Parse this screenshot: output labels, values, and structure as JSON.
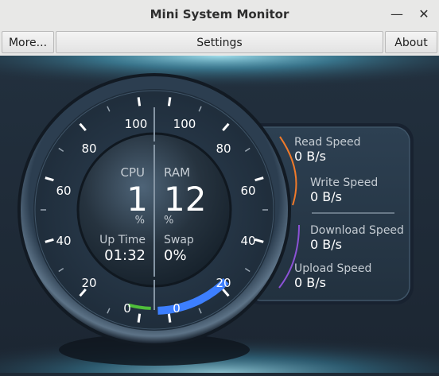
{
  "window": {
    "title": "Mini System Monitor",
    "minimize_glyph": "—",
    "close_glyph": "✕"
  },
  "toolbar": {
    "more_label": "More...",
    "settings_label": "Settings",
    "about_label": "About"
  },
  "gauge": {
    "left_ticks": [
      "100",
      "80",
      "60",
      "40",
      "20",
      "0"
    ],
    "right_ticks": [
      "100",
      "80",
      "60",
      "40",
      "20",
      "0"
    ],
    "cpu": {
      "label": "CPU",
      "value": "1",
      "unit": "%"
    },
    "ram": {
      "label": "RAM",
      "value": "12",
      "unit": "%"
    },
    "uptime": {
      "label": "Up Time",
      "value": "01:32"
    },
    "swap": {
      "label": "Swap",
      "value": "0%"
    }
  },
  "disk": {
    "read_label": "Read Speed",
    "read_value": "0 B/s",
    "write_label": "Write Speed",
    "write_value": "0 B/s"
  },
  "network": {
    "download_label": "Download Speed",
    "download_value": "0 B/s",
    "upload_label": "Upload Speed",
    "upload_value": "0 B/s"
  },
  "levels": {
    "cpu_percent": 1,
    "ram_percent": 12
  },
  "colors": {
    "cpu_arc": "#4fbf3a",
    "ram_arc": "#3d7fff",
    "disk_arc": "#f07a2a",
    "net_arc": "#8b52d6",
    "glow": "#7fd6ea"
  }
}
